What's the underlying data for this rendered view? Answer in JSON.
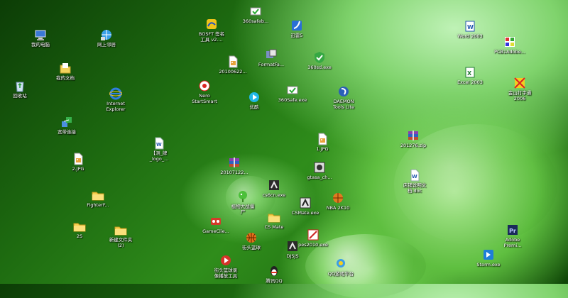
{
  "desktop": {
    "icons": [
      {
        "label": "我的电脑",
        "icon": "computer-icon"
      },
      {
        "label": "网上邻居",
        "icon": "network-icon"
      },
      {
        "label": "我的文档",
        "icon": "documents-icon"
      },
      {
        "label": "回收站",
        "icon": "recycle-bin-icon"
      },
      {
        "label": "Internet\nExplorer",
        "icon": "ie-icon"
      },
      {
        "label": "宽带连接",
        "icon": "broadband-icon"
      },
      {
        "label": "2.JPG",
        "icon": "image-file-icon"
      },
      {
        "label": "FighterF...",
        "icon": "folder-icon"
      },
      {
        "label": "2S",
        "icon": "folder-icon"
      },
      {
        "label": "新建文件夹\n(2)",
        "icon": "folder-icon"
      },
      {
        "label": "【测_牌\n_logo_...",
        "icon": "word-doc-icon"
      },
      {
        "label": "BOSFT 签名\n工具 v2....",
        "icon": "bosft-icon"
      },
      {
        "label": "20100622...",
        "icon": "image-file-icon"
      },
      {
        "label": "Nero\nStartSmart",
        "icon": "nero-icon"
      },
      {
        "label": "360safeb...",
        "icon": "360-safe-icon"
      },
      {
        "label": "FormatFa...",
        "icon": "format-icon"
      },
      {
        "label": "优酷",
        "icon": "youku-icon"
      },
      {
        "label": "迅雷5",
        "icon": "thunder-icon"
      },
      {
        "label": "360sd.exe",
        "icon": "360-antivirus-icon"
      },
      {
        "label": "360Safe.exe",
        "icon": "360-safe-icon"
      },
      {
        "label": "DAEMON\nTools Lite",
        "icon": "daemon-tools-icon"
      },
      {
        "label": "1.JPG",
        "icon": "image-file-icon"
      },
      {
        "label": "20107122...",
        "icon": "rar-archive-icon"
      },
      {
        "label": "gtasa_ch...",
        "icon": "gta-icon"
      },
      {
        "label": "cs6cn.exe",
        "icon": "cs-game-icon"
      },
      {
        "label": "植物大战僵\n尸",
        "icon": "plants-zombies-icon"
      },
      {
        "label": "CSMate.exe",
        "icon": "csmate-icon"
      },
      {
        "label": "NBA 2K10",
        "icon": "nba-icon"
      },
      {
        "label": "GameClie...",
        "icon": "game-client-icon"
      },
      {
        "label": "CS Mate",
        "icon": "folder-icon"
      },
      {
        "label": "街头篮球",
        "icon": "basketball-icon"
      },
      {
        "label": "pes2010.exe",
        "icon": "pes-icon"
      },
      {
        "label": "DJSJS",
        "icon": "cs-game-icon"
      },
      {
        "label": "街头篮球录\n像播放工具",
        "icon": "replay-tool-icon"
      },
      {
        "label": "QQ游戏平台",
        "icon": "qq-game-icon"
      },
      {
        "label": "腾讯QQ",
        "icon": "qq-icon"
      },
      {
        "label": "201276.zip",
        "icon": "rar-archive-icon"
      },
      {
        "label": "店铺说明文\n档.doc",
        "icon": "word-doc-icon"
      },
      {
        "label": "Word 2003",
        "icon": "word-app-icon"
      },
      {
        "label": "PCB1Adobe...",
        "icon": "pcb-icon"
      },
      {
        "label": "Excel 2003",
        "icon": "excel-app-icon"
      },
      {
        "label": "金山打字通\n2006",
        "icon": "typing-icon"
      },
      {
        "label": "Adobe\nPremi...",
        "icon": "premiere-icon"
      },
      {
        "label": "Storm.exe",
        "icon": "storm-icon"
      }
    ]
  }
}
